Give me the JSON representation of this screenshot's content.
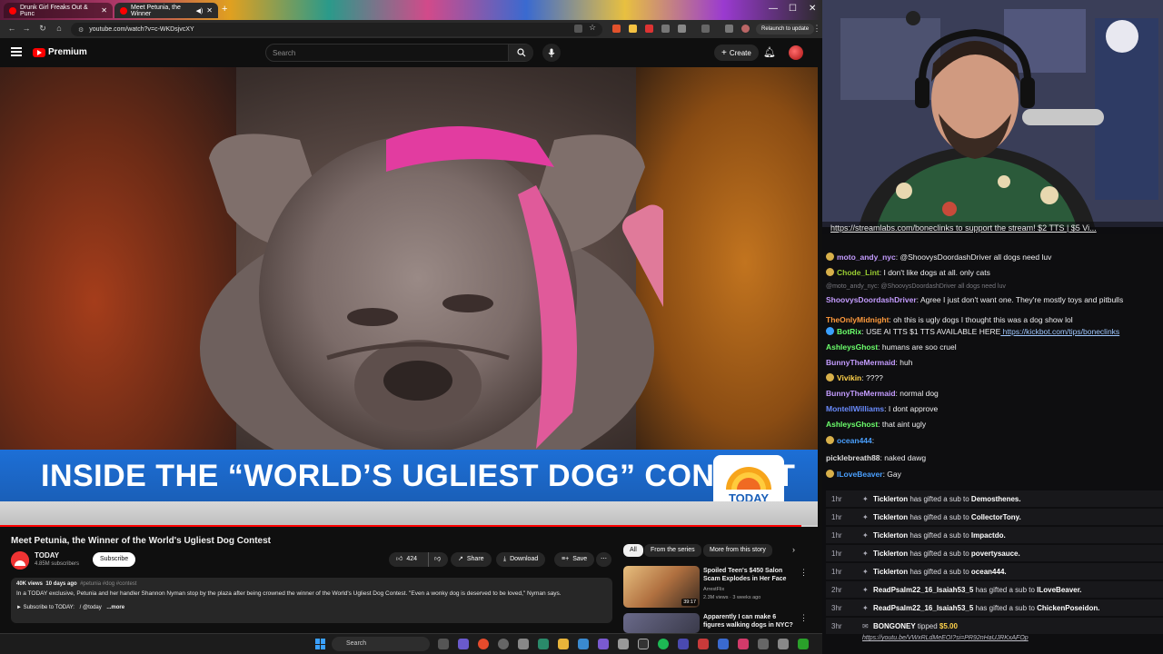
{
  "browser": {
    "tabs": [
      {
        "title": "Drunk Girl Freaks Out & Punc"
      },
      {
        "title": "Meet Petunia, the Winner"
      }
    ],
    "url": "youtube.com/watch?v=c-WKDsjvcXY",
    "relaunch_label": "Relaunch to update"
  },
  "youtube": {
    "logo_text": "Premium",
    "search_placeholder": "Search",
    "create_label": "Create",
    "video": {
      "lower_third": "INSIDE THE “WORLD’S UGLIEST DOG” CONTEST",
      "badge_text": "TODAY",
      "progress_fraction": 0.98
    },
    "title": "Meet Petunia, the Winner of the World's Ugliest Dog Contest",
    "channel": {
      "name": "TODAY",
      "subs": "4.85M subscribers"
    },
    "subscribe_label": "Subscribe",
    "actions": {
      "likes": "424",
      "share": "Share",
      "download": "Download",
      "save": "Save"
    },
    "description": {
      "views": "40K views",
      "age": "10 days ago",
      "tags": "#petunia #dog #contest",
      "text": "In a TODAY exclusive, Petunia and her handler Shannon Nyman stop by the plaza after being crowned the winner of the World's Ugliest Dog Contest. \"Even a wonky dog is deserved to be loved,\" Nyman says.",
      "subscribe_line": "► Subscribe to TODAY:",
      "handle": "/ @today",
      "more": "...more"
    },
    "chips": [
      "All",
      "From the series",
      "More from this story"
    ],
    "related": [
      {
        "title": "Spoiled Teen's $450 Salon Scam Explodes in Her Face",
        "channel": "ArrestFlix",
        "meta": "2.3M views · 3 weeks ago",
        "duration": "39:17"
      },
      {
        "title": "Apparently I can make 6 figures walking dogs in NYC?",
        "channel": "",
        "meta": "",
        "duration": ""
      }
    ],
    "taskbar_search": "Search"
  },
  "stream": {
    "donation_banner": "https://streamlabs.com/boneclinks to support the stream! $2 TTS | $5 Vi...",
    "chat": [
      {
        "user": "moto_andy_nyc",
        "color": "#c49cff",
        "text": "@ShoovysDoordashDriver all dogs need luv",
        "badge": "#d8b04a"
      },
      {
        "user": "Chode_Lint",
        "color": "#9acd32",
        "text": "I don't like dogs at all. only cats",
        "badge": "#d8b04a"
      },
      {
        "user": "",
        "color": "",
        "text": "@moto_andy_nyc: @ShoovysDoordashDriver all dogs need luv",
        "reply": true
      },
      {
        "user": "ShoovysDoordashDriver",
        "color": "#c49cff",
        "text": "Agree I just don't want one. They're mostly toys and pitbulls"
      },
      {
        "user": "TheOnlyMidnight",
        "color": "#ff9a3c",
        "text": "oh this is ugly dogs I thought this was a dog show lol"
      },
      {
        "user": "BotRix",
        "color": "#6cff6c",
        "text": "USE AI TTS $1 TTS AVAILABLE HERE",
        "link": "https://kickbot.com/tips/boneclinks",
        "badge": "#3aa0ff"
      },
      {
        "user": "AshleysGhost",
        "color": "#6cff6c",
        "text": "humans are soo cruel"
      },
      {
        "user": "BunnyTheMermaid",
        "color": "#c49cff",
        "text": "huh"
      },
      {
        "user": "Vivikin",
        "color": "#ffd24a",
        "text": "????",
        "badge": "#d8b04a"
      },
      {
        "user": "BunnyTheMermaid",
        "color": "#c49cff",
        "text": "normal dog"
      },
      {
        "user": "MontellWilliams",
        "color": "#6a8cff",
        "text": "I dont approve"
      },
      {
        "user": "AshleysGhost",
        "color": "#6cff6c",
        "text": "that aint ugly"
      },
      {
        "user": "ocean444",
        "color": "#4aa0ff",
        "text": "",
        "badge": "#d8b04a"
      },
      {
        "user": "picklebreath88",
        "color": "#dedede",
        "text": "naked dawg"
      },
      {
        "user": "ILoveBeaver",
        "color": "#4aa0ff",
        "text": "Gay",
        "badge": "#d8b04a"
      }
    ],
    "activity": [
      {
        "time": "1hr",
        "user": "Ticklerton",
        "action": "has gifted a sub to",
        "target": "Demosthenes."
      },
      {
        "time": "1hr",
        "user": "Ticklerton",
        "action": "has gifted a sub to",
        "target": "CollectorTony."
      },
      {
        "time": "1hr",
        "user": "Ticklerton",
        "action": "has gifted a sub to",
        "target": "Impactdo."
      },
      {
        "time": "1hr",
        "user": "Ticklerton",
        "action": "has gifted a sub to",
        "target": "povertysauce."
      },
      {
        "time": "1hr",
        "user": "Ticklerton",
        "action": "has gifted a sub to",
        "target": "ocean444."
      },
      {
        "time": "2hr",
        "user": "ReadPsalm22_16_Isaiah53_5",
        "action": "has gifted a sub to",
        "target": "ILoveBeaver."
      },
      {
        "time": "3hr",
        "user": "ReadPsalm22_16_Isaiah53_5",
        "action": "has gifted a sub to",
        "target": "ChickenPoseidon."
      },
      {
        "time": "3hr",
        "user": "BONGONEY",
        "action": "tipped",
        "target": "$5.00"
      }
    ],
    "tip_link": "https://youtu.be/VWxRLdMeEOI?si=PR92nHaUJRKxAFOp"
  }
}
